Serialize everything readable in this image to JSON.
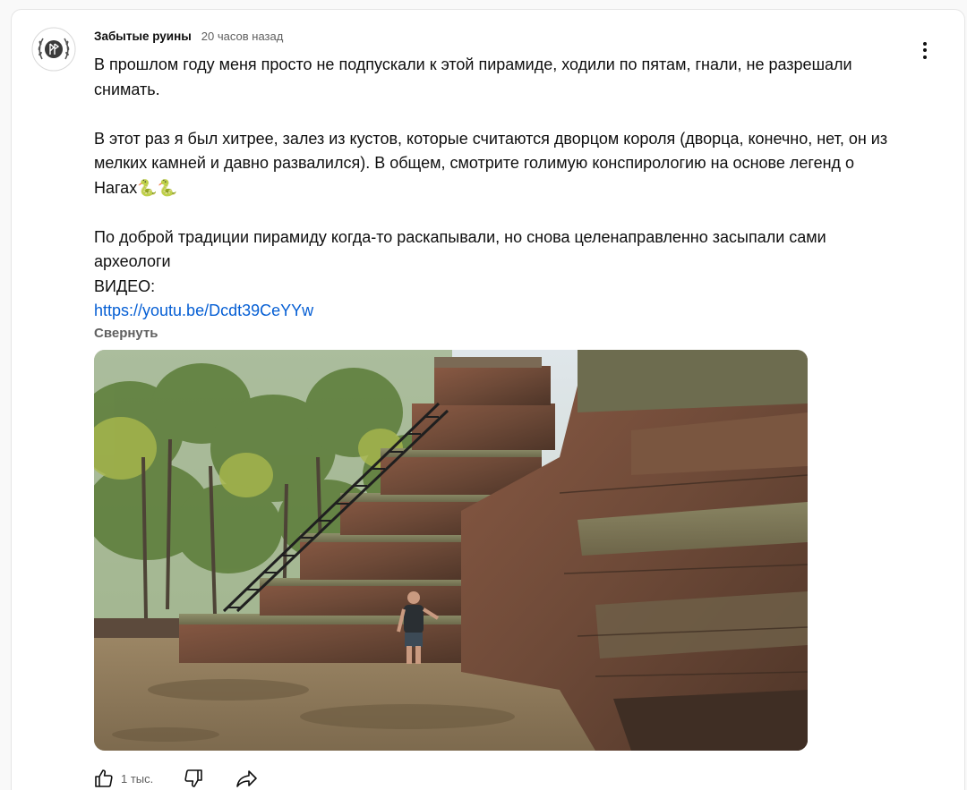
{
  "comment": {
    "author": "Забытые руины",
    "time": "20 часов назад",
    "paragraphs": [
      "В прошлом году меня просто не подпускали к этой пирамиде, ходили по пятам, гнали, не разрешали снимать.",
      "В этот раз я был хитрее, залез из кустов, которые считаются дворцом короля (дворца, конечно, нет, он из мелких камней и давно развалился). В общем, смотрите голимую конспирологию на основе легенд о Нагах",
      "По доброй традиции пирамиду когда-то раскапывали, но снова целенаправленно засыпали сами археологи",
      "ВИДЕО:"
    ],
    "emoji": "🐍🐍",
    "link": "https://youtu.be/Dcdt39CeYYw",
    "collapse_label": "Свернуть",
    "photo_alt": "stepped laterite pyramid with wooden staircase and a man standing at its base"
  },
  "actions": {
    "likes_count": "1 тыс.",
    "like_icon": "thumb-up-icon",
    "dislike_icon": "thumb-down-icon",
    "share_icon": "share-icon",
    "menu_icon": "more-vertical-icon"
  },
  "colors": {
    "link": "#065fd4",
    "secondary_text": "#606060",
    "primary_text": "#0f0f0f",
    "card_border": "#e5e5e5"
  }
}
